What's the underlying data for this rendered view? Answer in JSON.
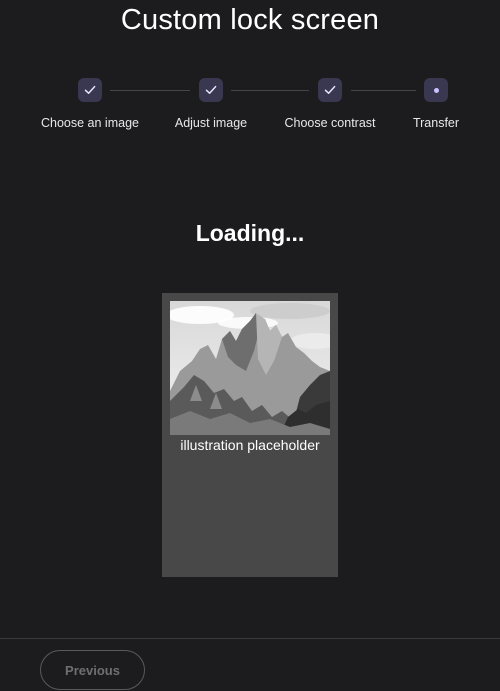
{
  "header": {
    "title": "Custom lock screen"
  },
  "stepper": {
    "steps": [
      {
        "label": "Choose an image",
        "state": "completed",
        "icon": "check-icon"
      },
      {
        "label": "Adjust image",
        "state": "completed",
        "icon": "check-icon"
      },
      {
        "label": "Choose contrast",
        "state": "completed",
        "icon": "check-icon"
      },
      {
        "label": "Transfer",
        "state": "active",
        "icon": "dot-icon"
      }
    ]
  },
  "main": {
    "status": "Loading...",
    "preview": {
      "caption": "illustration placeholder",
      "image": "grayscale-mountain-illustration"
    }
  },
  "footer": {
    "previous_label": "Previous",
    "previous_disabled": true
  },
  "colors": {
    "background": "#1c1c1e",
    "step_circle": "#3a3750",
    "step_accent": "#c8c3ff",
    "preview_card": "#484848",
    "disabled_text": "#6f6f73"
  }
}
